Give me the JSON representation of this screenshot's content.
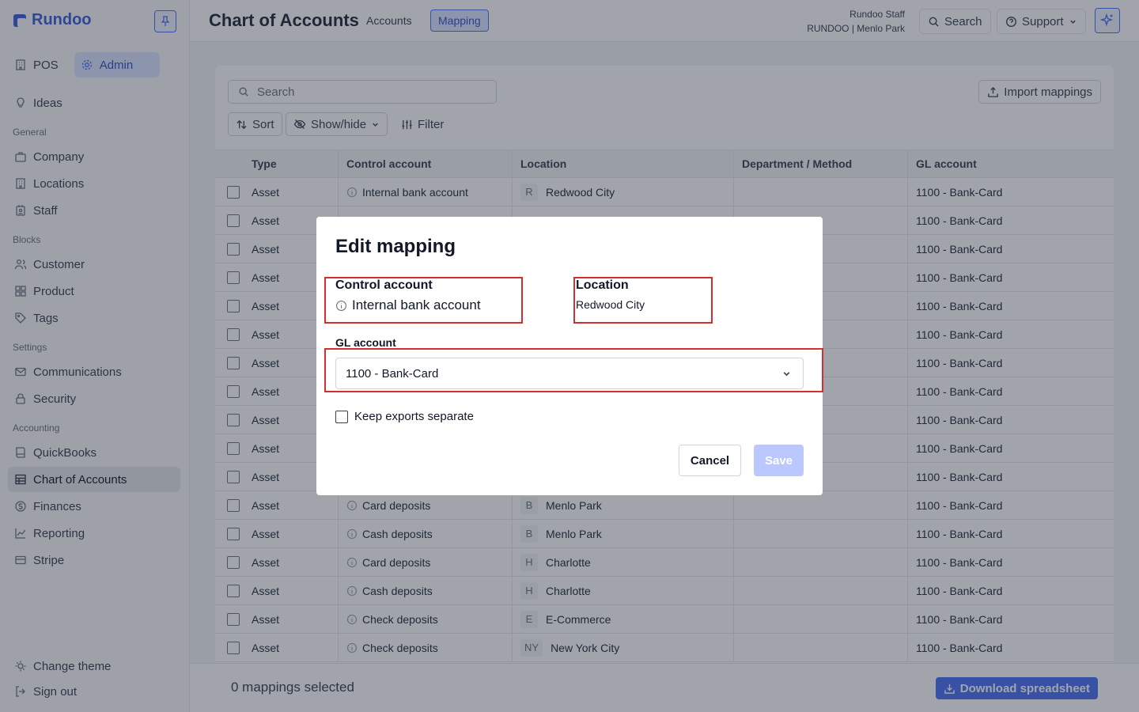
{
  "brand": {
    "name": "Rundoo"
  },
  "sidebar": {
    "modes": [
      {
        "label": "POS",
        "icon": "building-icon"
      },
      {
        "label": "Admin",
        "icon": "gear-icon"
      }
    ],
    "ideas": "Ideas",
    "sections": {
      "general": "General",
      "blocks": "Blocks",
      "settings": "Settings",
      "accounting": "Accounting"
    },
    "general_items": [
      {
        "label": "Company",
        "icon": "briefcase-icon"
      },
      {
        "label": "Locations",
        "icon": "building-icon"
      },
      {
        "label": "Staff",
        "icon": "id-badge-icon"
      }
    ],
    "block_items": [
      {
        "label": "Customer",
        "icon": "users-icon"
      },
      {
        "label": "Product",
        "icon": "grid-icon"
      },
      {
        "label": "Tags",
        "icon": "tag-icon"
      }
    ],
    "settings_items": [
      {
        "label": "Communications",
        "icon": "mail-icon"
      },
      {
        "label": "Security",
        "icon": "lock-icon"
      }
    ],
    "accounting_items": [
      {
        "label": "QuickBooks",
        "icon": "book-icon"
      },
      {
        "label": "Chart of Accounts",
        "icon": "table-icon"
      },
      {
        "label": "Finances",
        "icon": "dollar-icon"
      },
      {
        "label": "Reporting",
        "icon": "chart-line-icon"
      },
      {
        "label": "Stripe",
        "icon": "card-icon"
      }
    ],
    "change_theme": "Change theme",
    "sign_out": "Sign out"
  },
  "header": {
    "title": "Chart of Accounts",
    "tabs": [
      "Accounts",
      "Mapping"
    ],
    "staff_name": "Rundoo Staff",
    "staff_org": "RUNDOO | Menlo Park",
    "search": "Search",
    "support": "Support"
  },
  "toolbar": {
    "search_placeholder": "Search",
    "import": "Import mappings",
    "sort": "Sort",
    "show_hide": "Show/hide",
    "filter": "Filter"
  },
  "table": {
    "columns": [
      "Type",
      "Control account",
      "Location",
      "Department / Method",
      "GL account"
    ],
    "rows": [
      {
        "type": "Asset",
        "control": "Internal bank account",
        "loc_badge": "R",
        "location": "Redwood City",
        "gl": "1100 - Bank-Card"
      },
      {
        "type": "Asset",
        "control": "",
        "loc_badge": "",
        "location": "",
        "gl": "1100 - Bank-Card"
      },
      {
        "type": "Asset",
        "control": "",
        "loc_badge": "",
        "location": "",
        "gl": "1100 - Bank-Card"
      },
      {
        "type": "Asset",
        "control": "",
        "loc_badge": "",
        "location": "",
        "gl": "1100 - Bank-Card"
      },
      {
        "type": "Asset",
        "control": "",
        "loc_badge": "",
        "location": "",
        "gl": "1100 - Bank-Card"
      },
      {
        "type": "Asset",
        "control": "",
        "loc_badge": "",
        "location": "",
        "gl": "1100 - Bank-Card"
      },
      {
        "type": "Asset",
        "control": "",
        "loc_badge": "",
        "location": "",
        "gl": "1100 - Bank-Card"
      },
      {
        "type": "Asset",
        "control": "",
        "loc_badge": "",
        "location": "",
        "gl": "1100 - Bank-Card"
      },
      {
        "type": "Asset",
        "control": "",
        "loc_badge": "",
        "location": "",
        "gl": "1100 - Bank-Card"
      },
      {
        "type": "Asset",
        "control": "",
        "loc_badge": "",
        "location": "",
        "gl": "1100 - Bank-Card"
      },
      {
        "type": "Asset",
        "control": "",
        "loc_badge": "",
        "location": "",
        "gl": "1100 - Bank-Card"
      },
      {
        "type": "Asset",
        "control": "Card deposits",
        "loc_badge": "B",
        "location": "Menlo Park",
        "gl": "1100 - Bank-Card"
      },
      {
        "type": "Asset",
        "control": "Cash deposits",
        "loc_badge": "B",
        "location": "Menlo Park",
        "gl": "1100 - Bank-Card"
      },
      {
        "type": "Asset",
        "control": "Card deposits",
        "loc_badge": "H",
        "location": "Charlotte",
        "gl": "1100 - Bank-Card"
      },
      {
        "type": "Asset",
        "control": "Cash deposits",
        "loc_badge": "H",
        "location": "Charlotte",
        "gl": "1100 - Bank-Card"
      },
      {
        "type": "Asset",
        "control": "Check deposits",
        "loc_badge": "E",
        "location": "E-Commerce",
        "gl": "1100 - Bank-Card"
      },
      {
        "type": "Asset",
        "control": "Check deposits",
        "loc_badge": "NY",
        "location": "New York City",
        "gl": "1100 - Bank-Card"
      }
    ]
  },
  "footer": {
    "selected": "0 mappings selected",
    "download": "Download spreadsheet"
  },
  "modal": {
    "title": "Edit mapping",
    "control_label": "Control account",
    "control_value": "Internal bank account",
    "location_label": "Location",
    "location_value": "Redwood City",
    "gl_label": "GL account",
    "gl_value": "1100 - Bank-Card",
    "keep_label": "Keep exports separate",
    "cancel": "Cancel",
    "save": "Save"
  },
  "colors": {
    "accent": "#4c6ef5",
    "highlight": "#d32f2f",
    "overlay": "rgba(31,41,55,0.42)"
  }
}
